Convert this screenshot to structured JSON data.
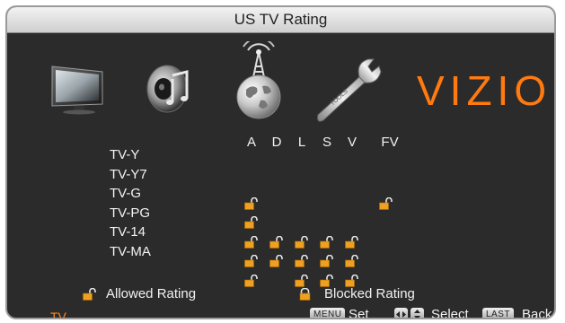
{
  "window": {
    "title": "US TV Rating"
  },
  "menu_icons": [
    {
      "name": "picture-icon"
    },
    {
      "name": "audio-icon"
    },
    {
      "name": "tv-antenna-icon"
    },
    {
      "name": "settings-wrench-icon"
    }
  ],
  "brand": {
    "text": "VIZIO",
    "color": "#ff7a10"
  },
  "grid": {
    "columns": [
      "A",
      "D",
      "L",
      "S",
      "V",
      "FV"
    ],
    "rows": [
      {
        "label": "TV-Y",
        "cells": [
          "",
          "",
          "",
          "",
          "",
          ""
        ]
      },
      {
        "label": "TV-Y7",
        "cells": [
          "allowed",
          "",
          "",
          "",
          "",
          "allowed"
        ]
      },
      {
        "label": "TV-G",
        "cells": [
          "allowed",
          "",
          "",
          "",
          "",
          ""
        ]
      },
      {
        "label": "TV-PG",
        "cells": [
          "allowed",
          "allowed",
          "allowed",
          "allowed",
          "allowed",
          ""
        ]
      },
      {
        "label": "TV-14",
        "cells": [
          "allowed",
          "allowed",
          "allowed",
          "allowed",
          "allowed",
          ""
        ]
      },
      {
        "label": "TV-MA",
        "cells": [
          "allowed",
          "",
          "allowed",
          "allowed",
          "allowed",
          ""
        ]
      }
    ]
  },
  "legend": {
    "allowed_label": "Allowed Rating",
    "blocked_label": "Blocked Rating"
  },
  "bottom_bar": {
    "source": "TV",
    "menu_badge": "MENU",
    "set_label": "Set",
    "select_label": "Select",
    "last_badge": "LAST",
    "back_label": "Back"
  },
  "colors": {
    "accent": "#ff7a10",
    "lock": "#f0a020",
    "panel": "#2b2b2b"
  }
}
